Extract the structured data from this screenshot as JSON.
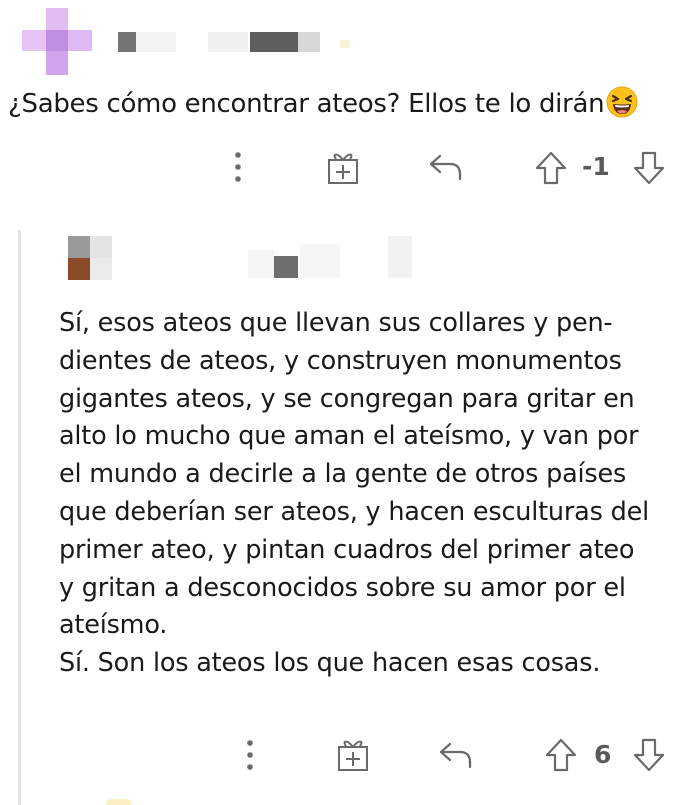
{
  "comment_1": {
    "author_avatar": "blurred-avatar",
    "text": "¿Sabes cómo encontrar ateos? Ellos te lo dirán",
    "emoji": "laughing-squinting-face",
    "actions": {
      "more_icon": "more-vertical-icon",
      "award_icon": "gift-icon",
      "reply_icon": "reply-icon",
      "upvote_icon": "arrow-up-icon",
      "score": "-1",
      "downvote_icon": "arrow-down-icon"
    }
  },
  "comment_2": {
    "author_avatar": "blurred-avatar",
    "lines": [
      "Sí, esos ateos que llevan sus collares y pen-",
      "dientes de ateos, y construyen monumentos",
      "gigantes ateos, y se congregan para gritar en",
      "alto lo mucho que aman el ateísmo, y van por",
      "el mundo a decirle a la gente de otros países",
      "que deberían ser ateos, y hacen esculturas del",
      "primer ateo, y pintan cuadros del primer ateo",
      "y gritan a desconocidos sobre su amor por el",
      "ateísmo.",
      "Sí. Son los ateos los que hacen esas cosas."
    ],
    "actions": {
      "more_icon": "more-vertical-icon",
      "award_icon": "gift-icon",
      "reply_icon": "reply-icon",
      "upvote_icon": "arrow-up-icon",
      "score": "6",
      "downvote_icon": "arrow-down-icon"
    }
  },
  "colors": {
    "text": "#1a1a1b",
    "icon": "#6a6a6a",
    "thread_line": "#e2e2e2",
    "avatar_1": "#c78ee8",
    "avatar_2_accent": "#8b4a2a"
  }
}
